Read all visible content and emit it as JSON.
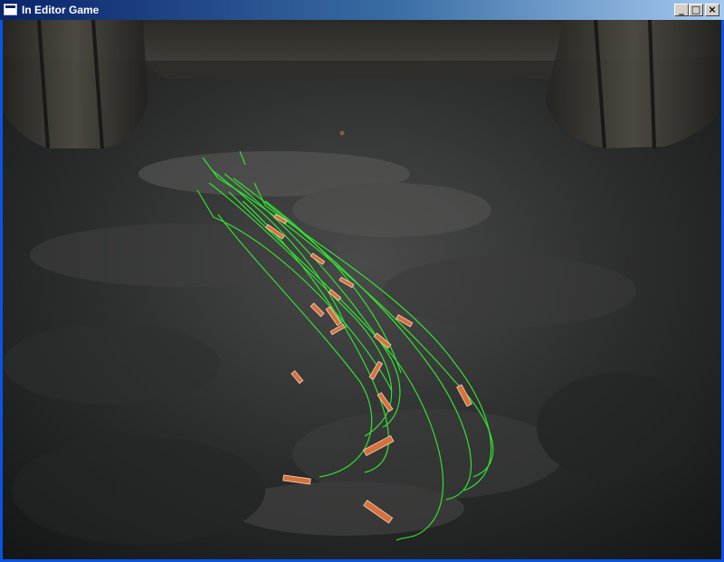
{
  "window": {
    "title": "In Editor Game",
    "controls": {
      "minimize": "_",
      "maximize": "□",
      "close": "×"
    }
  },
  "scene": {
    "description_icon": "game-viewport",
    "path_color": "#33e033",
    "projectile_color": "#d8703a",
    "floor_color": "#2a2b2b",
    "pillar_color": "#3b3a36"
  }
}
